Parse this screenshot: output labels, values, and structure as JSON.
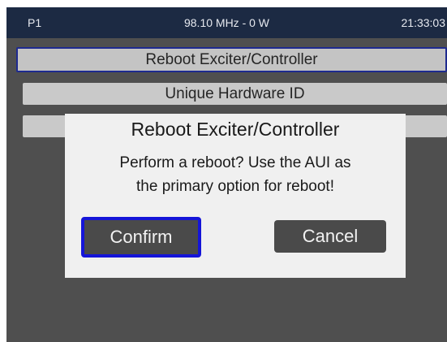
{
  "status_bar": {
    "preset": "P1",
    "frequency_power": "98.10 MHz - 0 W",
    "clock": "21:33:03"
  },
  "menu": {
    "items": [
      {
        "label": "Reboot Exciter/Controller",
        "selected": true
      },
      {
        "label": "Unique Hardware ID",
        "selected": false
      },
      {
        "label": "",
        "selected": false
      }
    ]
  },
  "dialog": {
    "title": "Reboot Exciter/Controller",
    "message_lines": [
      "Perform a reboot? Use the AUI as",
      "the primary option for reboot!"
    ],
    "confirm_label": "Confirm",
    "cancel_label": "Cancel"
  },
  "colors": {
    "status_bar_bg": "#1c2a43",
    "screen_bg": "#4f4f4f",
    "menu_item_bg": "#c9c9c9",
    "selection_border": "#1e2a8f",
    "dialog_bg": "#f0f0f0",
    "button_bg": "#4a4a4a",
    "focus_border": "#1515d8"
  }
}
